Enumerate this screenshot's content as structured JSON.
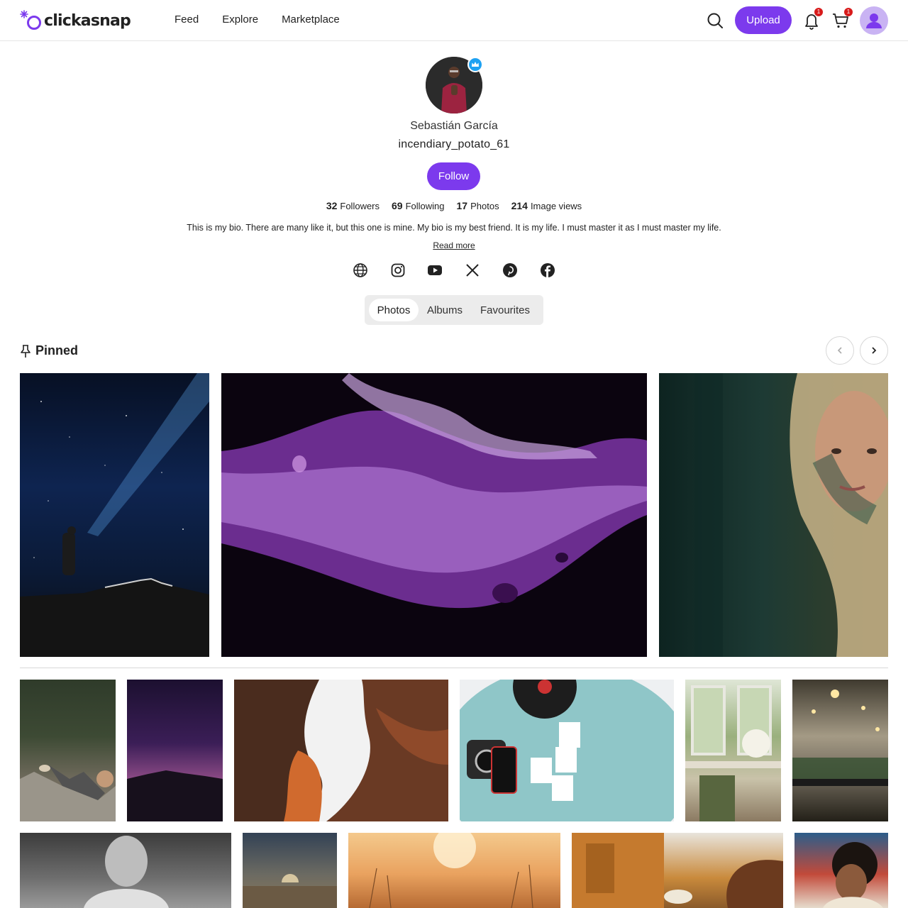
{
  "brand": {
    "name": "clickasnap"
  },
  "nav": {
    "items": [
      "Feed",
      "Explore",
      "Marketplace"
    ]
  },
  "header": {
    "upload_label": "Upload",
    "notifications_count": "1",
    "cart_count": "1",
    "accent_color": "#7c3aed"
  },
  "profile": {
    "display_name": "Sebastián García",
    "username": "incendiary_potato_61",
    "follow_label": "Follow",
    "stats": [
      {
        "value": "32",
        "label": "Followers"
      },
      {
        "value": "69",
        "label": "Following"
      },
      {
        "value": "17",
        "label": "Photos"
      },
      {
        "value": "214",
        "label": "Image views"
      }
    ],
    "bio": "This is my bio. There are many like it, but this one is mine. My bio is my best friend. It is my life. I must master it as I must master my life.",
    "read_more": "Read more",
    "socials": [
      "website-icon",
      "instagram-icon",
      "youtube-icon",
      "x-icon",
      "pinterest-icon",
      "facebook-icon"
    ]
  },
  "tabs": {
    "items": [
      "Photos",
      "Albums",
      "Favourites"
    ],
    "active": "Photos"
  },
  "pinned": {
    "title": "Pinned"
  }
}
